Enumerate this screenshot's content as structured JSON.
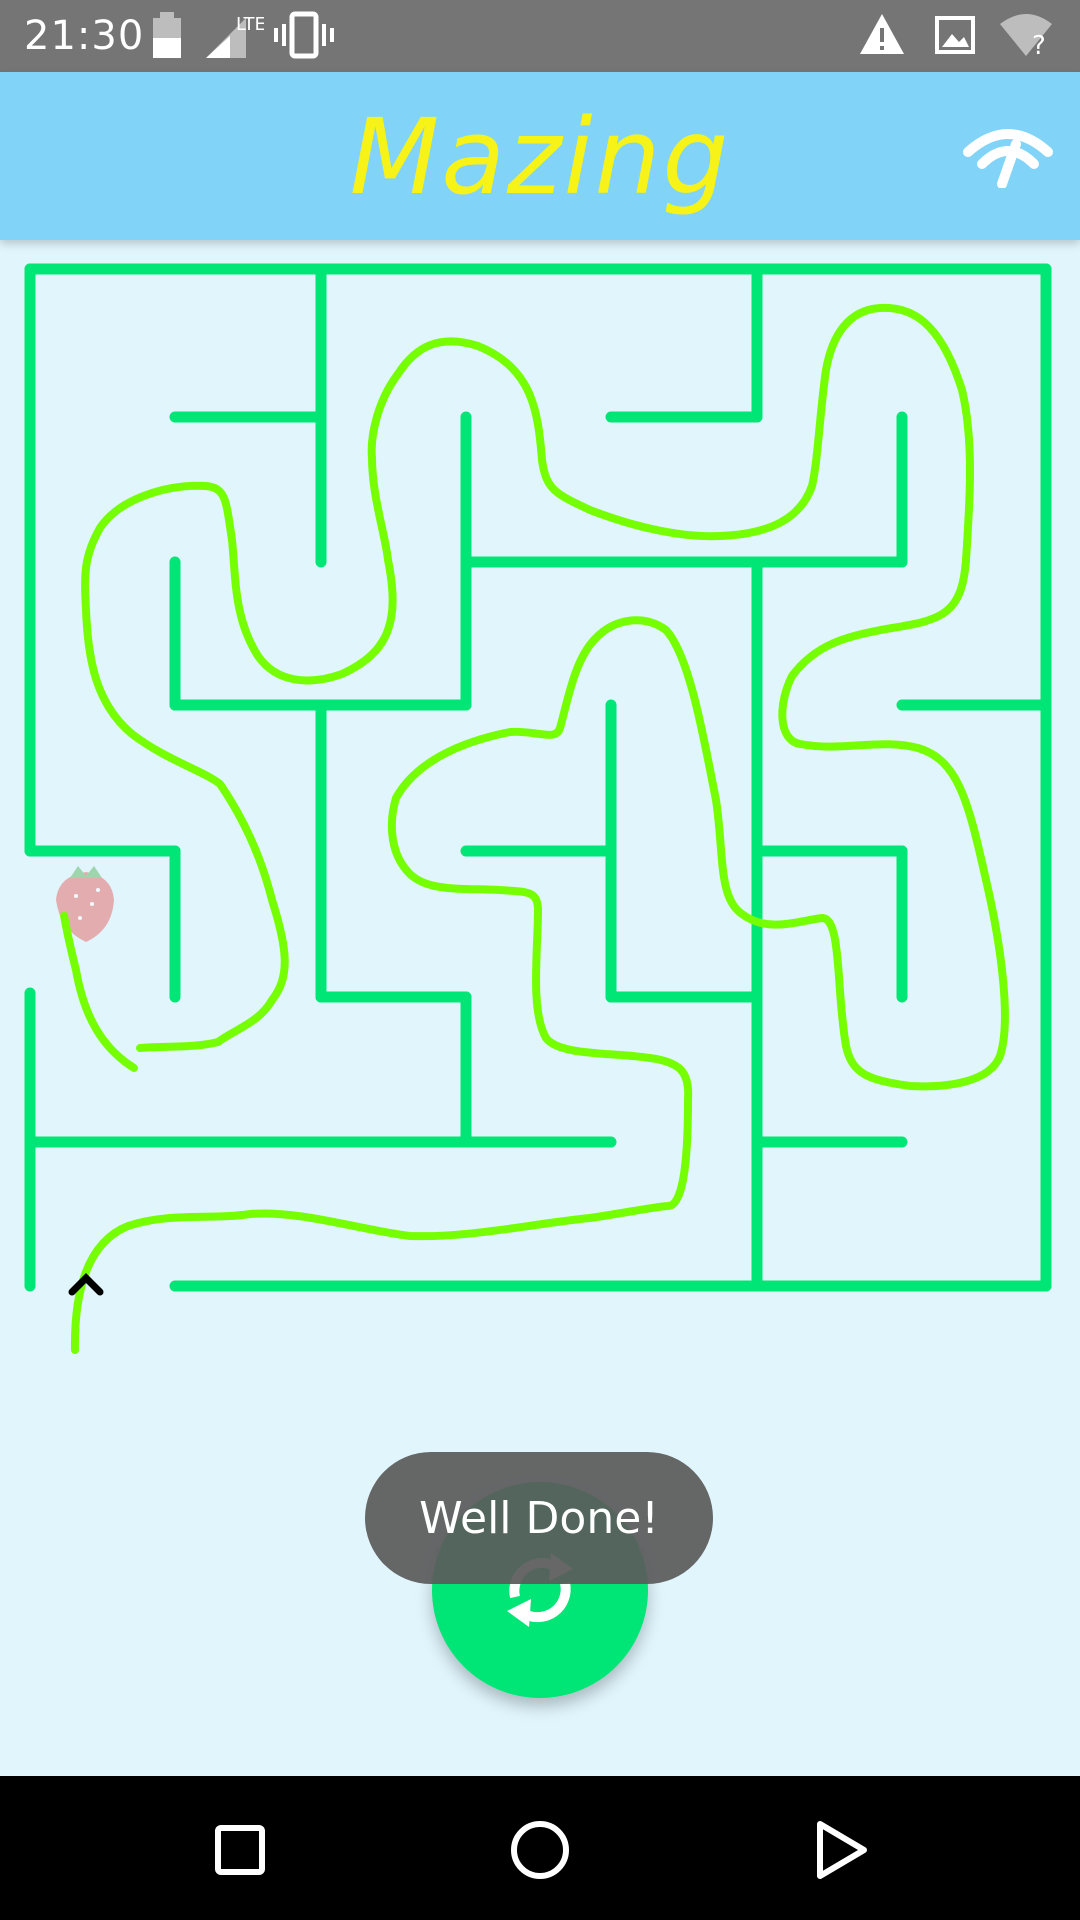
{
  "status_bar": {
    "time": "21:30",
    "icons": [
      "battery-icon",
      "lte-signal-icon",
      "vibrate-icon",
      "warning-icon",
      "image-icon",
      "wifi-unknown-icon"
    ],
    "lte_label": "LTE"
  },
  "app_bar": {
    "title": "Mazing",
    "action_icon": "speed-meter-icon"
  },
  "maze": {
    "wall_color": "#00e676",
    "path_color": "#76ff03",
    "goal_icon": "strawberry-icon",
    "start_icon": "caret-up-icon"
  },
  "toast": {
    "message": "Well Done!"
  },
  "fab": {
    "icon": "refresh-icon"
  },
  "nav_bar": {
    "icons": [
      "recents-square-icon",
      "home-circle-icon",
      "back-triangle-icon"
    ]
  }
}
